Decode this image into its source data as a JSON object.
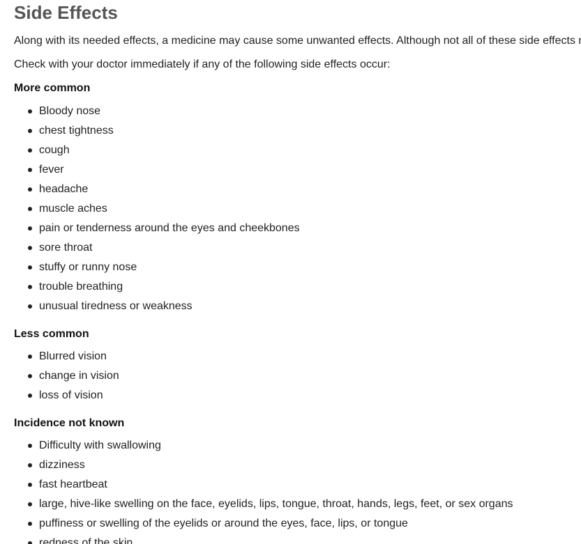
{
  "title": "Side Effects",
  "intro": "Along with its needed effects, a medicine may cause some unwanted effects. Although not all of these side effects may occur, if they do occur they may need medical attention.",
  "instruction": "Check with your doctor immediately if any of the following side effects occur:",
  "sections": [
    {
      "heading": "More common",
      "items": [
        "Bloody nose",
        "chest tightness",
        "cough",
        "fever",
        "headache",
        "muscle aches",
        "pain or tenderness around the eyes and cheekbones",
        "sore throat",
        "stuffy or runny nose",
        "trouble breathing",
        "unusual tiredness or weakness"
      ]
    },
    {
      "heading": "Less common",
      "items": [
        "Blurred vision",
        "change in vision",
        "loss of vision"
      ]
    },
    {
      "heading": "Incidence not known",
      "items": [
        "Difficulty with swallowing",
        "dizziness",
        "fast heartbeat",
        "large, hive-like swelling on the face, eyelids, lips, tongue, throat, hands, legs, feet, or sex organs",
        "puffiness or swelling of the eyelids or around the eyes, face, lips, or tongue",
        "redness of the skin"
      ]
    }
  ]
}
